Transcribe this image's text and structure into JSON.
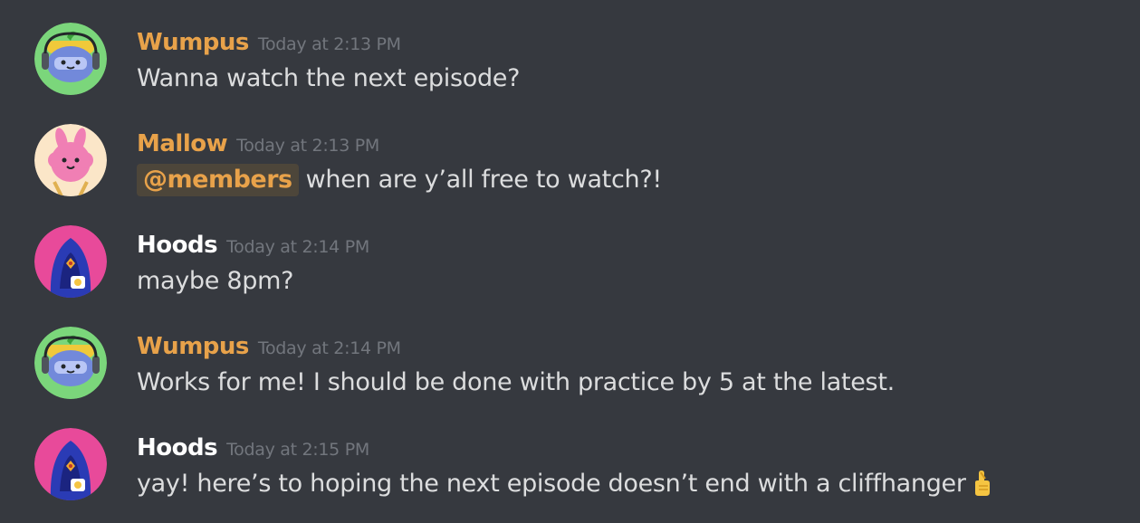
{
  "colors": {
    "background": "#36393f",
    "wumpus_name": "#e8a24a",
    "mallow_name": "#e8a24a",
    "hoods_name": "#ffffff",
    "timestamp": "#72767d",
    "message_text": "#dcddde",
    "mention": "#e8a24a"
  },
  "messages": [
    {
      "author": "Wumpus",
      "timestamp": "Today at 2:13 PM",
      "text": "Wanna watch the next episode?",
      "avatar_icon": "wumpus-avatar-icon"
    },
    {
      "author": "Mallow",
      "timestamp": "Today at 2:13 PM",
      "mention": "@members",
      "text": "when are y’all free to watch?!",
      "avatar_icon": "mallow-avatar-icon"
    },
    {
      "author": "Hoods",
      "timestamp": "Today at 2:14 PM",
      "text": "maybe 8pm?",
      "avatar_icon": "hoods-avatar-icon"
    },
    {
      "author": "Wumpus",
      "timestamp": "Today at 2:14 PM",
      "text": "Works for me! I should be done with practice by 5 at the latest.",
      "avatar_icon": "wumpus-avatar-icon"
    },
    {
      "author": "Hoods",
      "timestamp": "Today at 2:15 PM",
      "text": "yay! here’s to hoping the next episode doesn’t end with a cliffhanger",
      "emoji": "crossed-fingers-icon",
      "avatar_icon": "hoods-avatar-icon"
    }
  ]
}
